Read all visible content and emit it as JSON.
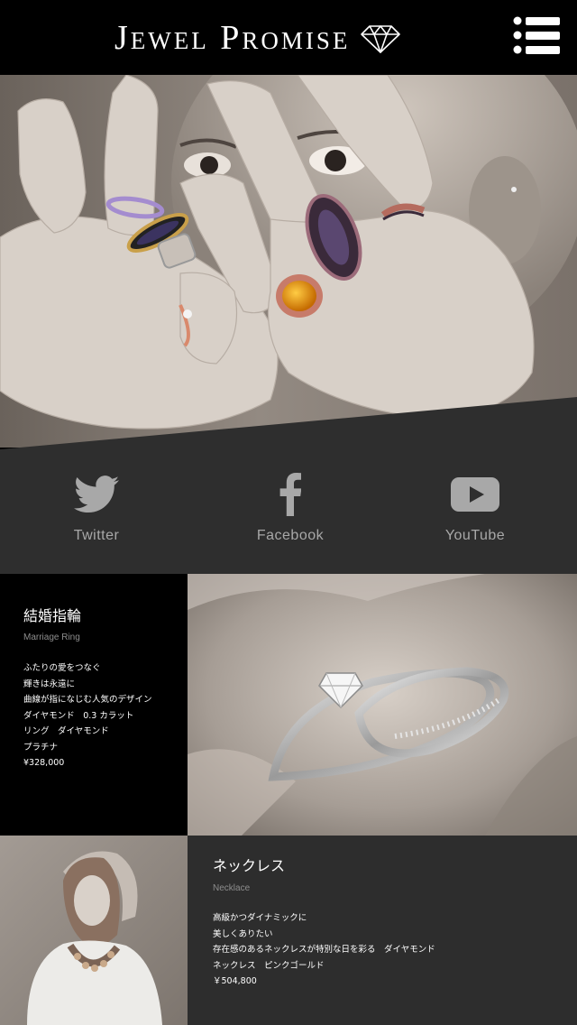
{
  "header": {
    "brand": "Jewel Promise"
  },
  "social": {
    "items": [
      {
        "label": "Twitter",
        "icon": "twitter-bird-icon"
      },
      {
        "label": "Facebook",
        "icon": "facebook-f-icon"
      },
      {
        "label": "YouTube",
        "icon": "youtube-play-icon"
      }
    ]
  },
  "products": {
    "ring": {
      "title": "結婚指輪",
      "subtitle": "Marriage Ring",
      "lines": [
        "ふたりの愛をつなぐ",
        "輝きは永遠に",
        "",
        "曲線が指になじむ人気のデザイン",
        "",
        "ダイヤモンド　0.3 カラット",
        "リング　ダイヤモンド",
        "プラチナ",
        "¥328,000"
      ]
    },
    "necklace": {
      "title": "ネックレス",
      "subtitle": "Necklace",
      "lines": [
        "高級かつダイナミックに",
        "美しくありたい",
        "",
        "存在感のあるネックレスが特別な日を彩る　ダイヤモンド",
        "ネックレス　ピンクゴールド",
        "￥504,800"
      ]
    }
  },
  "colors": {
    "header_bg": "#000000",
    "social_bg": "#2e2e2e",
    "icon_gray": "#a8a8a8",
    "ring_panel_bg": "#000000",
    "necklace_panel_bg": "#2d2d2d"
  }
}
